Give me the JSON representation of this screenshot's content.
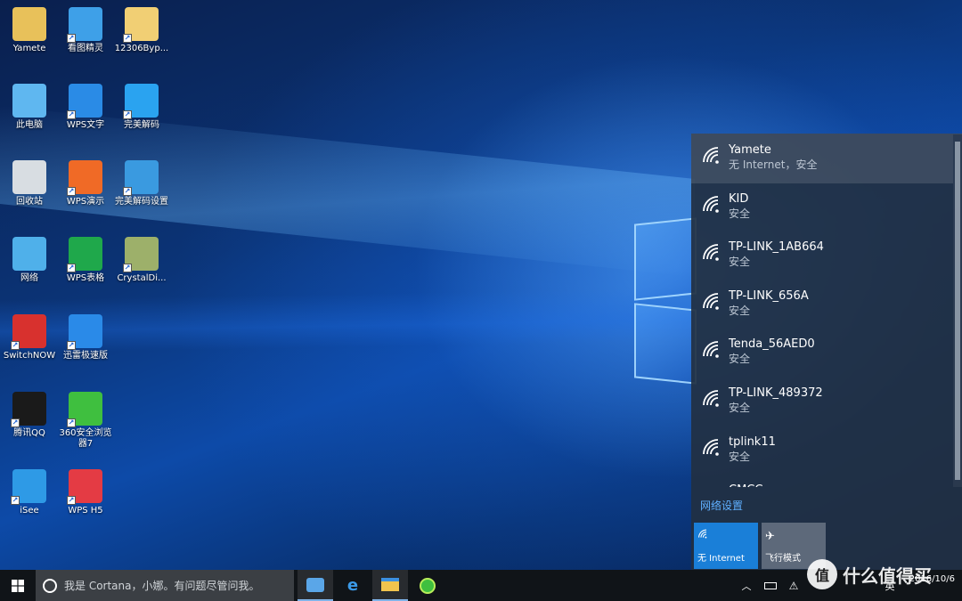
{
  "desktop": {
    "icons": [
      {
        "label": "Yamete",
        "icon": "folder-user-icon",
        "color": "#e8c15a"
      },
      {
        "label": "看图精灵",
        "icon": "image-viewer-icon",
        "color": "#3ea0e8"
      },
      {
        "label": "12306Byp...",
        "icon": "folder-icon",
        "color": "#f1cf74"
      },
      {
        "label": "此电脑",
        "icon": "computer-icon",
        "color": "#5fb7f0"
      },
      {
        "label": "WPS文字",
        "icon": "wps-writer-icon",
        "color": "#2a8be6"
      },
      {
        "label": "完美解码",
        "icon": "media-player-icon",
        "color": "#2aa3f0"
      },
      {
        "label": "回收站",
        "icon": "recycle-bin-icon",
        "color": "#d8dde2"
      },
      {
        "label": "WPS演示",
        "icon": "wps-presentation-icon",
        "color": "#f06a26"
      },
      {
        "label": "完美解码设置",
        "icon": "settings-gear-icon",
        "color": "#3a9ae0"
      },
      {
        "label": "网络",
        "icon": "network-icon",
        "color": "#4fb0ea"
      },
      {
        "label": "WPS表格",
        "icon": "wps-spreadsheet-icon",
        "color": "#1fa84b"
      },
      {
        "label": "CrystalDi...",
        "icon": "disk-info-icon",
        "color": "#9db06a"
      },
      {
        "label": "SwitchNOW",
        "icon": "switchnow-icon",
        "color": "#d8312e"
      },
      {
        "label": "迅雷极速版",
        "icon": "thunder-icon",
        "color": "#2a8ae8"
      },
      {
        "label": "腾讯QQ",
        "icon": "qq-penguin-icon",
        "color": "#1a1a1a"
      },
      {
        "label": "360安全浏览器7",
        "icon": "360-browser-icon",
        "color": "#3fbf3f"
      },
      {
        "label": "iSee",
        "icon": "isee-icon",
        "color": "#2e9ae6"
      },
      {
        "label": "WPS H5",
        "icon": "wps-h5-icon",
        "color": "#e43b44"
      }
    ]
  },
  "network_flyout": {
    "networks": [
      {
        "name": "Yamete",
        "status": "无 Internet，安全",
        "selected": true
      },
      {
        "name": "KID",
        "status": "安全",
        "selected": false
      },
      {
        "name": "TP-LINK_1AB664",
        "status": "安全",
        "selected": false
      },
      {
        "name": "TP-LINK_656A",
        "status": "安全",
        "selected": false
      },
      {
        "name": "Tenda_56AED0",
        "status": "安全",
        "selected": false
      },
      {
        "name": "TP-LINK_489372",
        "status": "安全",
        "selected": false
      },
      {
        "name": "tplink11",
        "status": "安全",
        "selected": false
      },
      {
        "name": "CMCC",
        "status": "",
        "selected": false
      }
    ],
    "settings_link": "网络设置",
    "tiles": {
      "internet_label": "无 Internet",
      "airplane_label": "飞行模式"
    },
    "accent": "#1a7fd8"
  },
  "taskbar": {
    "search_placeholder": "我是 Cortana，小娜。有问题尽管问我。",
    "tray_ime": "英",
    "clock_time": "",
    "clock_date": "2016/10/6"
  },
  "watermark": {
    "badge": "值",
    "text": "什么值得买"
  }
}
